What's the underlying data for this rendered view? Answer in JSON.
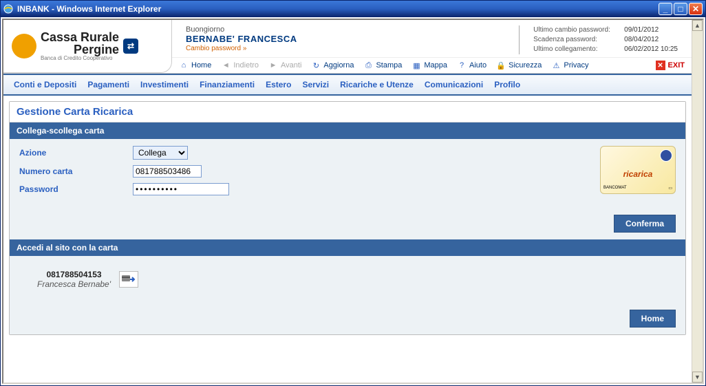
{
  "window": {
    "title": "INBANK - Windows Internet Explorer"
  },
  "header": {
    "bank_name_1": "Cassa Rurale",
    "bank_name_2": "Pergine",
    "bank_tagline": "Banca di Credito Cooperativo",
    "greeting": "Buongiorno",
    "user_name": "BERNABE' FRANCESCA",
    "change_password": "Cambio password »",
    "info": {
      "last_pw_label": "Ultimo cambio password:",
      "last_pw_value": "09/01/2012",
      "expiry_label": "Scadenza password:",
      "expiry_value": "08/04/2012",
      "last_login_label": "Ultimo collegamento:",
      "last_login_value": "06/02/2012 10:25"
    }
  },
  "toolbar": {
    "home": "Home",
    "back": "Indietro",
    "forward": "Avanti",
    "refresh": "Aggiorna",
    "print": "Stampa",
    "map": "Mappa",
    "help": "Aiuto",
    "security": "Sicurezza",
    "privacy": "Privacy",
    "exit": "EXIT"
  },
  "menu": {
    "conti": "Conti e Depositi",
    "pagamenti": "Pagamenti",
    "investimenti": "Investimenti",
    "finanziamenti": "Finanziamenti",
    "estero": "Estero",
    "servizi": "Servizi",
    "ricariche": "Ricariche e Utenze",
    "comunicazioni": "Comunicazioni",
    "profilo": "Profilo"
  },
  "panel": {
    "title": "Gestione Carta Ricarica",
    "section1_title": "Collega-scollega carta",
    "form": {
      "azione_label": "Azione",
      "azione_value": "Collega",
      "numero_label": "Numero carta",
      "numero_value": "081788503486",
      "password_label": "Password",
      "password_value": "••••••••••"
    },
    "card_brand": "ricarica",
    "confirm_btn": "Conferma",
    "section2_title": "Accedi al sito con la carta",
    "linked_number": "081788504153",
    "linked_name": "Francesca Bernabe'",
    "home_btn": "Home"
  }
}
